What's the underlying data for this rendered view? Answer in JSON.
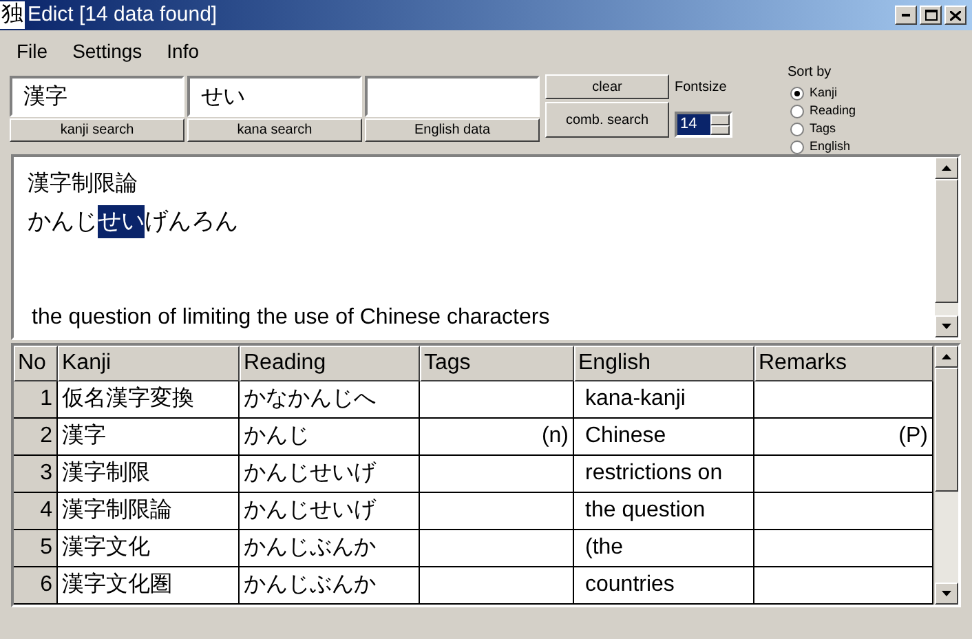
{
  "window": {
    "app_icon": "独",
    "title": "Edict [14 data found]"
  },
  "menu": [
    "File",
    "Settings",
    "Info"
  ],
  "search": {
    "searches": [
      {
        "value": "漢字",
        "button": "kanji search"
      },
      {
        "value": "せい",
        "button": "kana search"
      },
      {
        "button": "English data"
      }
    ],
    "clear": "clear",
    "comb_search": "comb. search",
    "fontsize": {
      "label": "Fontsize",
      "value": "14"
    },
    "sort": {
      "label": "Sort by",
      "options": [
        {
          "label": "Kanji",
          "selected": true
        },
        {
          "label": "Reading",
          "selected": false
        },
        {
          "label": "Tags",
          "selected": false
        },
        {
          "label": "English",
          "selected": false
        }
      ]
    }
  },
  "detail": {
    "kanji": "漢字制限論",
    "reading": [
      {
        "text": "かんじ",
        "highlighted": false
      },
      {
        "text": "せい",
        "highlighted": true
      },
      {
        "text": "げんろん",
        "highlighted": false
      }
    ],
    "english": "the question of limiting the use of Chinese characters"
  },
  "table": {
    "columns": [
      "No",
      "Kanji",
      "Reading",
      "Tags",
      "English",
      "Remarks"
    ],
    "rows": [
      {
        "no": "1",
        "kanji": "仮名漢字変換",
        "reading": "かなかんじへ",
        "english": "kana-kanji"
      },
      {
        "no": "2",
        "kanji": "漢字",
        "reading": "かんじ",
        "tags": "(n)",
        "english": "Chinese",
        "remarks": "(P)"
      },
      {
        "no": "3",
        "kanji": "漢字制限",
        "reading": "かんじせいげ",
        "english": "restrictions on"
      },
      {
        "no": "4",
        "kanji": "漢字制限論",
        "reading": "かんじせいげ",
        "english": "the question"
      },
      {
        "no": "5",
        "kanji": "漢字文化",
        "reading": "かんじぶんか",
        "english": "(the"
      },
      {
        "no": "6",
        "kanji": "漢字文化圏",
        "reading": "かんじぶんか",
        "english": "countries"
      }
    ]
  }
}
